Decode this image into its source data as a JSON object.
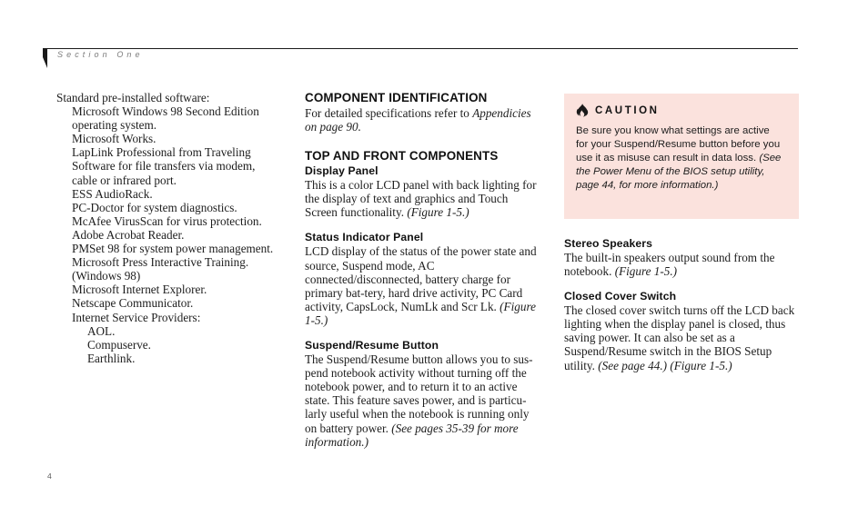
{
  "header": {
    "title": "S e c t i o n   O n e",
    "title_plain": "Section One",
    "marker_icon": "section-flag-icon"
  },
  "footer": {
    "page_number": "4"
  },
  "colors": {
    "caution_background": "#fbe2dd",
    "header_text": "#7b7b7b",
    "body_text": "#1d1d1d",
    "rule": "#1a1a1a"
  },
  "column_left": {
    "intro": "Standard pre-installed software:",
    "items": [
      {
        "indent": 1,
        "text": "Microsoft Windows 98 Second Edition"
      },
      {
        "indent": 1,
        "text": "operating system."
      },
      {
        "indent": 1,
        "text": "Microsoft Works."
      },
      {
        "indent": 1,
        "text": "LapLink Professional from Traveling"
      },
      {
        "indent": 1,
        "text": "Software for file transfers via modem,"
      },
      {
        "indent": 1,
        "text": "cable or infrared port."
      },
      {
        "indent": 1,
        "text": "ESS AudioRack."
      },
      {
        "indent": 1,
        "text": "PC-Doctor for system diagnostics."
      },
      {
        "indent": 1,
        "text": "McAfee VirusScan for virus protection."
      },
      {
        "indent": 1,
        "text": "Adobe Acrobat Reader."
      },
      {
        "indent": 1,
        "text": "PMSet 98 for system power management."
      },
      {
        "indent": 1,
        "text": "Microsoft Press Interactive Training."
      },
      {
        "indent": 1,
        "text": "(Windows 98)"
      },
      {
        "indent": 1,
        "text": "Microsoft Internet Explorer."
      },
      {
        "indent": 1,
        "text": "Netscape Communicator."
      },
      {
        "indent": 1,
        "text": "Internet Service Providers:"
      },
      {
        "indent": 2,
        "text": "AOL."
      },
      {
        "indent": 2,
        "text": "Compuserve."
      },
      {
        "indent": 2,
        "text": "Earthlink."
      }
    ]
  },
  "column_middle": {
    "heading": "COMPONENT IDENTIFICATION",
    "intro_plain": "For detailed specifications refer to ",
    "intro_italic": "Appendicies on page 90.",
    "section_heading": "TOP AND FRONT COMPONENTS",
    "blocks": [
      {
        "subheading": "Display Panel",
        "body_plain": "This is a color LCD panel with back lighting for the display of text and graphics and Touch Screen functionality. ",
        "body_italic": "(Figure 1-5.)"
      },
      {
        "subheading": "Status Indicator Panel",
        "body_plain": "LCD display of the status of the power state and source, Suspend mode, AC connected/disconnected, battery charge for primary bat-tery, hard drive activity, PC Card activity, CapsLock, NumLk and Scr Lk. ",
        "body_italic": "(Figure 1-5.)"
      },
      {
        "subheading": "Suspend/Resume Button",
        "body_plain": "The Suspend/Resume button allows you to sus-pend notebook activity without turning off the notebook power, and to return it to an active state. This feature saves power, and is particu-larly useful when the notebook is running only on battery power. ",
        "body_italic": "(See pages 35-39 for more information.)"
      }
    ]
  },
  "caution": {
    "icon": "flame-icon",
    "title": "C A U T I O N",
    "title_plain": "CAUTION",
    "body_plain": "Be sure you know what settings are active for your Suspend/Resume button before you use it as misuse can result in data loss. ",
    "body_italic": "(See the Power Menu of the BIOS setup utility, page 44, for more information.)"
  },
  "column_right": {
    "blocks": [
      {
        "subheading": "Stereo Speakers",
        "body_plain": "The built-in speakers output sound from the notebook. ",
        "body_italic": "(Figure 1-5.)"
      },
      {
        "subheading": "Closed Cover Switch",
        "body_plain": "The closed cover switch turns off the LCD back lighting when the display panel is closed, thus saving power. It can also be set as a Suspend/Resume switch in the BIOS Setup utility. ",
        "body_italic": "(See page 44.) (Figure 1-5.)"
      }
    ]
  }
}
